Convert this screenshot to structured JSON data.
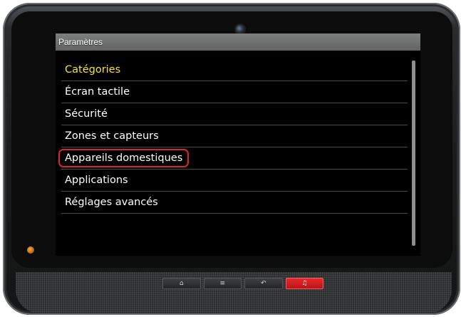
{
  "window": {
    "title": "Paramètres"
  },
  "menu": {
    "items": [
      {
        "label": "Catégories"
      },
      {
        "label": "Écran tactile"
      },
      {
        "label": "Sécurité"
      },
      {
        "label": "Zones et capteurs"
      },
      {
        "label": "Appareils domestiques"
      },
      {
        "label": "Applications"
      },
      {
        "label": "Réglages avancés"
      }
    ],
    "highlighted_item": "Appareils domestiques"
  },
  "nav_buttons": {
    "home": "⌂",
    "menu": "≡",
    "back": "↶",
    "alarm": "♫"
  },
  "colors": {
    "header_text": "#f5e62a",
    "highlight_outline": "#e0242b",
    "alarm_button": "#e8292e"
  }
}
